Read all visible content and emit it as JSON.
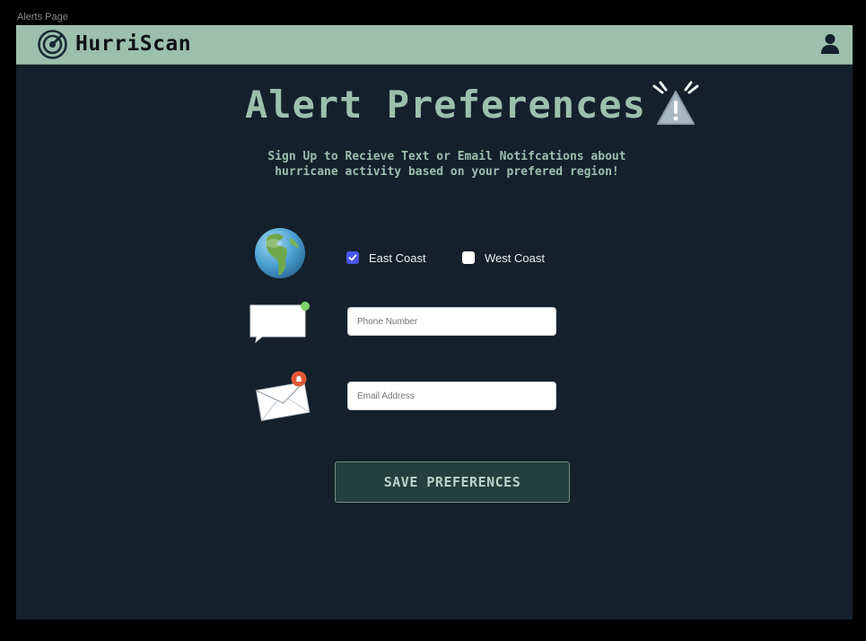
{
  "frame": {
    "label": "Alerts Page"
  },
  "navbar": {
    "brand": "HurriScan",
    "logo_icon": "radar-icon",
    "user_icon": "user-icon",
    "color": "#9dbfad"
  },
  "main": {
    "title": "Alert Preferences",
    "title_icon": "warning-siren-icon",
    "subtitle_line1": "Sign Up to Recieve Text or Email Notifcations about",
    "subtitle_line2": "hurricane activity based on your prefered region!"
  },
  "regions": {
    "east": {
      "label": "East Coast",
      "checked": true
    },
    "west": {
      "label": "West Coast",
      "checked": false
    }
  },
  "icons": {
    "globe": "globe-icon",
    "chat": "chat-bubble-icon",
    "mail": "envelope-icon"
  },
  "form": {
    "phone_placeholder": "Phone Number",
    "phone_value": "",
    "email_placeholder": "Email Address",
    "email_value": "",
    "save_label": "SAVE PREFERENCES"
  },
  "colors": {
    "background": "#14212c",
    "accent": "#9dbfad",
    "checkbox": "#4a57e8",
    "button": "#253f3e"
  }
}
